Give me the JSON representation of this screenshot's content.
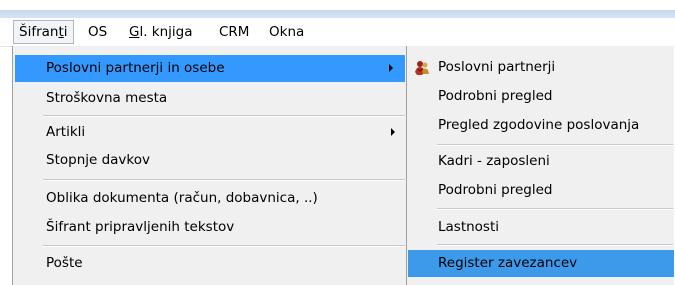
{
  "menubar": {
    "items": [
      {
        "label_pre": "Šifran",
        "label_u": "t",
        "label_post": "i"
      },
      {
        "label_pre": "OS",
        "label_u": "",
        "label_post": ""
      },
      {
        "label_pre": "",
        "label_u": "G",
        "label_post": "l. knjiga"
      },
      {
        "label_pre": "CRM",
        "label_u": "",
        "label_post": ""
      },
      {
        "label_pre": "Okna",
        "label_u": "",
        "label_post": ""
      }
    ]
  },
  "dropdown": {
    "items": [
      {
        "label": "Poslovni partnerji in osebe"
      },
      {
        "label": "Stroškovna mesta"
      },
      {
        "label": "Artikli"
      },
      {
        "label": "Stopnje davkov"
      },
      {
        "label": "Oblika dokumenta (račun, dobavnica, ..)"
      },
      {
        "label": "Šifrant pripravljenih tekstov"
      },
      {
        "label": "Pošte"
      }
    ]
  },
  "submenu": {
    "icon": "business-partner-icon",
    "items": [
      {
        "label": "Poslovni partnerji"
      },
      {
        "label": "Podrobni pregled"
      },
      {
        "label": "Pregled zgodovine poslovanja"
      },
      {
        "label": "Kadri - zaposleni"
      },
      {
        "label": "Podrobni pregled"
      },
      {
        "label": "Lastnosti"
      },
      {
        "label": "Register zavezancev"
      }
    ]
  },
  "colors": {
    "highlight": "#3399ff",
    "menu_bg": "#f0f0f0",
    "titlebar": "#c6d8ee"
  }
}
